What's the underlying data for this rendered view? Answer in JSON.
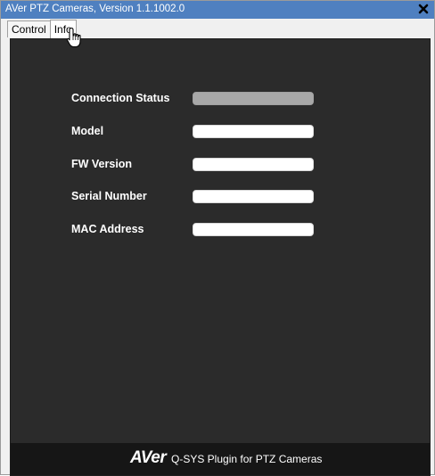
{
  "window": {
    "title": "AVer PTZ Cameras, Version 1.1.1002.0",
    "close_icon": "close-x-icon"
  },
  "tabs": [
    {
      "label": "Control",
      "active": false
    },
    {
      "label": "Info",
      "active": true
    }
  ],
  "info": {
    "fields": [
      {
        "label": "Connection Status",
        "value": ""
      },
      {
        "label": "Model",
        "value": ""
      },
      {
        "label": "FW Version",
        "value": ""
      },
      {
        "label": "Serial Number",
        "value": ""
      },
      {
        "label": "MAC Address",
        "value": ""
      }
    ]
  },
  "footer": {
    "logo": "AVer",
    "text": "Q-SYS Plugin for PTZ Cameras"
  },
  "colors": {
    "titlebar": "#4f80c0",
    "panel": "#2b2b2b",
    "footer": "#161616",
    "status_indicator": "#a8a8a8"
  },
  "cursor": "hand-pointer-icon"
}
